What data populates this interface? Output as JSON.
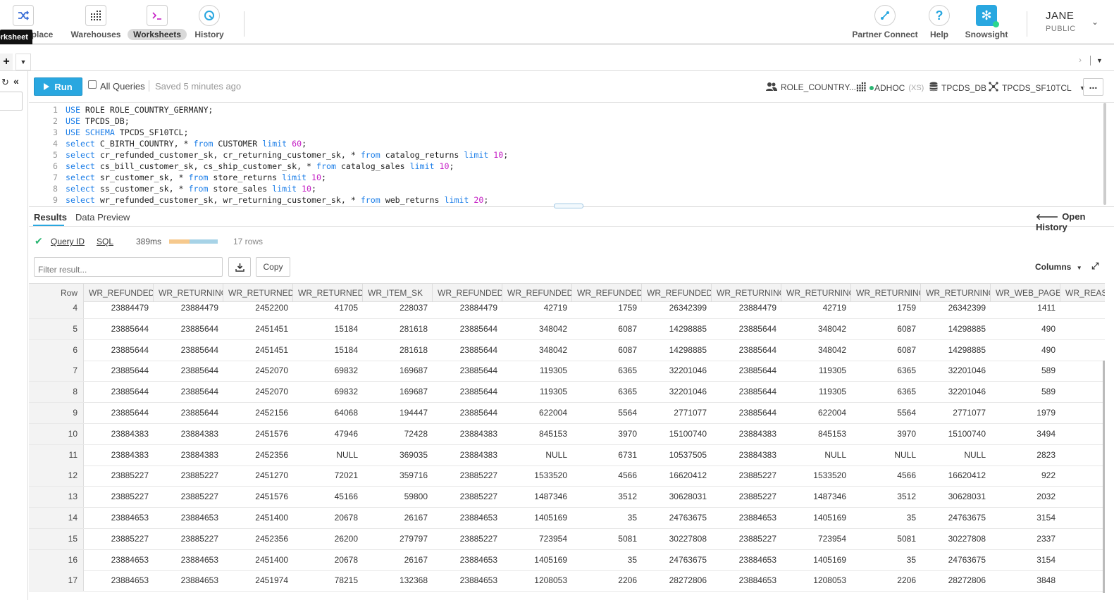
{
  "nav": {
    "left_items": [
      {
        "label": "tplace",
        "icon": "shuffle-icon"
      },
      {
        "label": "Warehouses",
        "icon": "warehouse-icon"
      },
      {
        "label": "Worksheets",
        "icon": "terminal-icon"
      },
      {
        "label": "History",
        "icon": "history-icon"
      }
    ],
    "right_items": [
      {
        "label": "Partner Connect",
        "icon": "partner-connect-icon"
      },
      {
        "label": "Help",
        "icon": "help-icon"
      },
      {
        "label": "Snowsight",
        "icon": "snowflake-icon"
      }
    ],
    "user_name": "JANE",
    "user_role": "PUBLIC",
    "tooltip": "orksheet"
  },
  "toolbar": {
    "run_label": "Run",
    "all_queries_label": "All Queries",
    "saved_text": "Saved 5 minutes ago",
    "role": "ROLE_COUNTRY...",
    "warehouse": "ADHOC",
    "warehouse_size": "(XS)",
    "database": "TPCDS_DB",
    "schema": "TPCDS_SF10TCL",
    "more_label": "..."
  },
  "editor": {
    "lines": [
      {
        "n": "1",
        "tokens": [
          [
            "kw",
            "USE"
          ],
          [
            "t",
            " ROLE ROLE_COUNTRY_GERMANY;"
          ]
        ]
      },
      {
        "n": "2",
        "tokens": [
          [
            "kw",
            "USE"
          ],
          [
            "t",
            " TPCDS_DB;"
          ]
        ]
      },
      {
        "n": "3",
        "tokens": [
          [
            "kw",
            "USE SCHEMA"
          ],
          [
            "t",
            " TPCDS_SF10TCL;"
          ]
        ]
      },
      {
        "n": "4",
        "tokens": [
          [
            "kw",
            "select"
          ],
          [
            "t",
            " C_BIRTH_COUNTRY, * "
          ],
          [
            "kw",
            "from"
          ],
          [
            "t",
            " CUSTOMER "
          ],
          [
            "kw",
            "limit"
          ],
          [
            "t",
            " "
          ],
          [
            "num",
            "60"
          ],
          [
            "t",
            ";"
          ]
        ]
      },
      {
        "n": "5",
        "tokens": [
          [
            "kw",
            "select"
          ],
          [
            "t",
            " cr_refunded_customer_sk, cr_returning_customer_sk, * "
          ],
          [
            "kw",
            "from"
          ],
          [
            "t",
            " catalog_returns "
          ],
          [
            "kw",
            "limit"
          ],
          [
            "t",
            " "
          ],
          [
            "num",
            "10"
          ],
          [
            "t",
            ";"
          ]
        ]
      },
      {
        "n": "6",
        "tokens": [
          [
            "kw",
            "select"
          ],
          [
            "t",
            " cs_bill_customer_sk, cs_ship_customer_sk, * "
          ],
          [
            "kw",
            "from"
          ],
          [
            "t",
            " catalog_sales "
          ],
          [
            "kw",
            "limit"
          ],
          [
            "t",
            " "
          ],
          [
            "num",
            "10"
          ],
          [
            "t",
            ";"
          ]
        ]
      },
      {
        "n": "7",
        "tokens": [
          [
            "kw",
            "select"
          ],
          [
            "t",
            " sr_customer_sk, * "
          ],
          [
            "kw",
            "from"
          ],
          [
            "t",
            " store_returns "
          ],
          [
            "kw",
            "limit"
          ],
          [
            "t",
            " "
          ],
          [
            "num",
            "10"
          ],
          [
            "t",
            ";"
          ]
        ]
      },
      {
        "n": "8",
        "tokens": [
          [
            "kw",
            "select"
          ],
          [
            "t",
            " ss_customer_sk, * "
          ],
          [
            "kw",
            "from"
          ],
          [
            "t",
            " store_sales "
          ],
          [
            "kw",
            "limit"
          ],
          [
            "t",
            " "
          ],
          [
            "num",
            "10"
          ],
          [
            "t",
            ";"
          ]
        ]
      },
      {
        "n": "9",
        "tokens": [
          [
            "kw",
            "select"
          ],
          [
            "t",
            " wr_refunded_customer_sk, wr_returning_customer_sk, * "
          ],
          [
            "kw",
            "from"
          ],
          [
            "t",
            " web_returns "
          ],
          [
            "kw",
            "limit"
          ],
          [
            "t",
            " "
          ],
          [
            "num",
            "20"
          ],
          [
            "t",
            ";"
          ]
        ]
      }
    ]
  },
  "results": {
    "tab_results": "Results",
    "tab_preview": "Data Preview",
    "open_history": "Open History",
    "query_id_label": "Query ID",
    "sql_label": "SQL",
    "duration": "389ms",
    "duration_bar_fraction": 0.42,
    "row_count": "17 rows",
    "filter_placeholder": "Filter result...",
    "copy_label": "Copy",
    "columns_label": "Columns"
  },
  "grid": {
    "headers": [
      "Row",
      "WR_REFUNDED_",
      "WR_RETURNING",
      "WR_RETURNED_",
      "WR_RETURNED_",
      "WR_ITEM_SK",
      "WR_REFUNDED_",
      "WR_REFUNDED_",
      "WR_REFUNDED_",
      "WR_REFUNDED_",
      "WR_RETURNING",
      "WR_RETURNING",
      "WR_RETURNING",
      "WR_RETURNING",
      "WR_WEB_PAGE_",
      "WR_REAS"
    ],
    "rows": [
      [
        "4",
        "23884479",
        "23884479",
        "2452200",
        "41705",
        "228037",
        "23884479",
        "42719",
        "1759",
        "26342399",
        "23884479",
        "42719",
        "1759",
        "26342399",
        "1411",
        ""
      ],
      [
        "5",
        "23885644",
        "23885644",
        "2451451",
        "15184",
        "281618",
        "23885644",
        "348042",
        "6087",
        "14298885",
        "23885644",
        "348042",
        "6087",
        "14298885",
        "490",
        ""
      ],
      [
        "6",
        "23885644",
        "23885644",
        "2451451",
        "15184",
        "281618",
        "23885644",
        "348042",
        "6087",
        "14298885",
        "23885644",
        "348042",
        "6087",
        "14298885",
        "490",
        ""
      ],
      [
        "7",
        "23885644",
        "23885644",
        "2452070",
        "69832",
        "169687",
        "23885644",
        "119305",
        "6365",
        "32201046",
        "23885644",
        "119305",
        "6365",
        "32201046",
        "589",
        ""
      ],
      [
        "8",
        "23885644",
        "23885644",
        "2452070",
        "69832",
        "169687",
        "23885644",
        "119305",
        "6365",
        "32201046",
        "23885644",
        "119305",
        "6365",
        "32201046",
        "589",
        ""
      ],
      [
        "9",
        "23885644",
        "23885644",
        "2452156",
        "64068",
        "194447",
        "23885644",
        "622004",
        "5564",
        "2771077",
        "23885644",
        "622004",
        "5564",
        "2771077",
        "1979",
        ""
      ],
      [
        "10",
        "23884383",
        "23884383",
        "2451576",
        "47946",
        "72428",
        "23884383",
        "845153",
        "3970",
        "15100740",
        "23884383",
        "845153",
        "3970",
        "15100740",
        "3494",
        ""
      ],
      [
        "11",
        "23884383",
        "23884383",
        "2452356",
        "NULL",
        "369035",
        "23884383",
        "NULL",
        "6731",
        "10537505",
        "23884383",
        "NULL",
        "NULL",
        "NULL",
        "2823",
        ""
      ],
      [
        "12",
        "23885227",
        "23885227",
        "2451270",
        "72021",
        "359716",
        "23885227",
        "1533520",
        "4566",
        "16620412",
        "23885227",
        "1533520",
        "4566",
        "16620412",
        "922",
        ""
      ],
      [
        "13",
        "23885227",
        "23885227",
        "2451576",
        "45166",
        "59800",
        "23885227",
        "1487346",
        "3512",
        "30628031",
        "23885227",
        "1487346",
        "3512",
        "30628031",
        "2032",
        ""
      ],
      [
        "14",
        "23884653",
        "23884653",
        "2451400",
        "20678",
        "26167",
        "23884653",
        "1405169",
        "35",
        "24763675",
        "23884653",
        "1405169",
        "35",
        "24763675",
        "3154",
        ""
      ],
      [
        "15",
        "23885227",
        "23885227",
        "2452356",
        "26200",
        "279797",
        "23885227",
        "723954",
        "5081",
        "30227808",
        "23885227",
        "723954",
        "5081",
        "30227808",
        "2337",
        ""
      ],
      [
        "16",
        "23884653",
        "23884653",
        "2451400",
        "20678",
        "26167",
        "23884653",
        "1405169",
        "35",
        "24763675",
        "23884653",
        "1405169",
        "35",
        "24763675",
        "3154",
        ""
      ],
      [
        "17",
        "23884653",
        "23884653",
        "2451974",
        "78215",
        "132368",
        "23884653",
        "1208053",
        "2206",
        "28272806",
        "23884653",
        "1208053",
        "2206",
        "28272806",
        "3848",
        ""
      ]
    ]
  }
}
